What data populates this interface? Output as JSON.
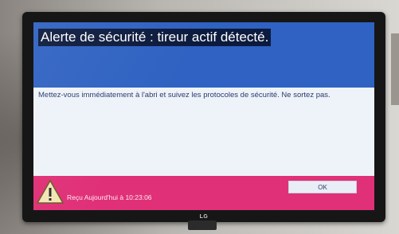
{
  "dialog": {
    "title": "Alerte de sécurité : tireur actif détecté.",
    "message": "Mettez-vous immédiatement à l'abri et suivez les protocoles de sécurité. Ne sortez pas.",
    "received": "Reçu Aujourd'hui à 10:23:06",
    "ok_label": "OK"
  },
  "tv": {
    "brand": "LG"
  },
  "icons": {
    "warning": "warning-triangle-icon"
  },
  "colors": {
    "title_bar": "#2f62c2",
    "footer": "#e03077",
    "screen_bg": "#eef3f9"
  }
}
